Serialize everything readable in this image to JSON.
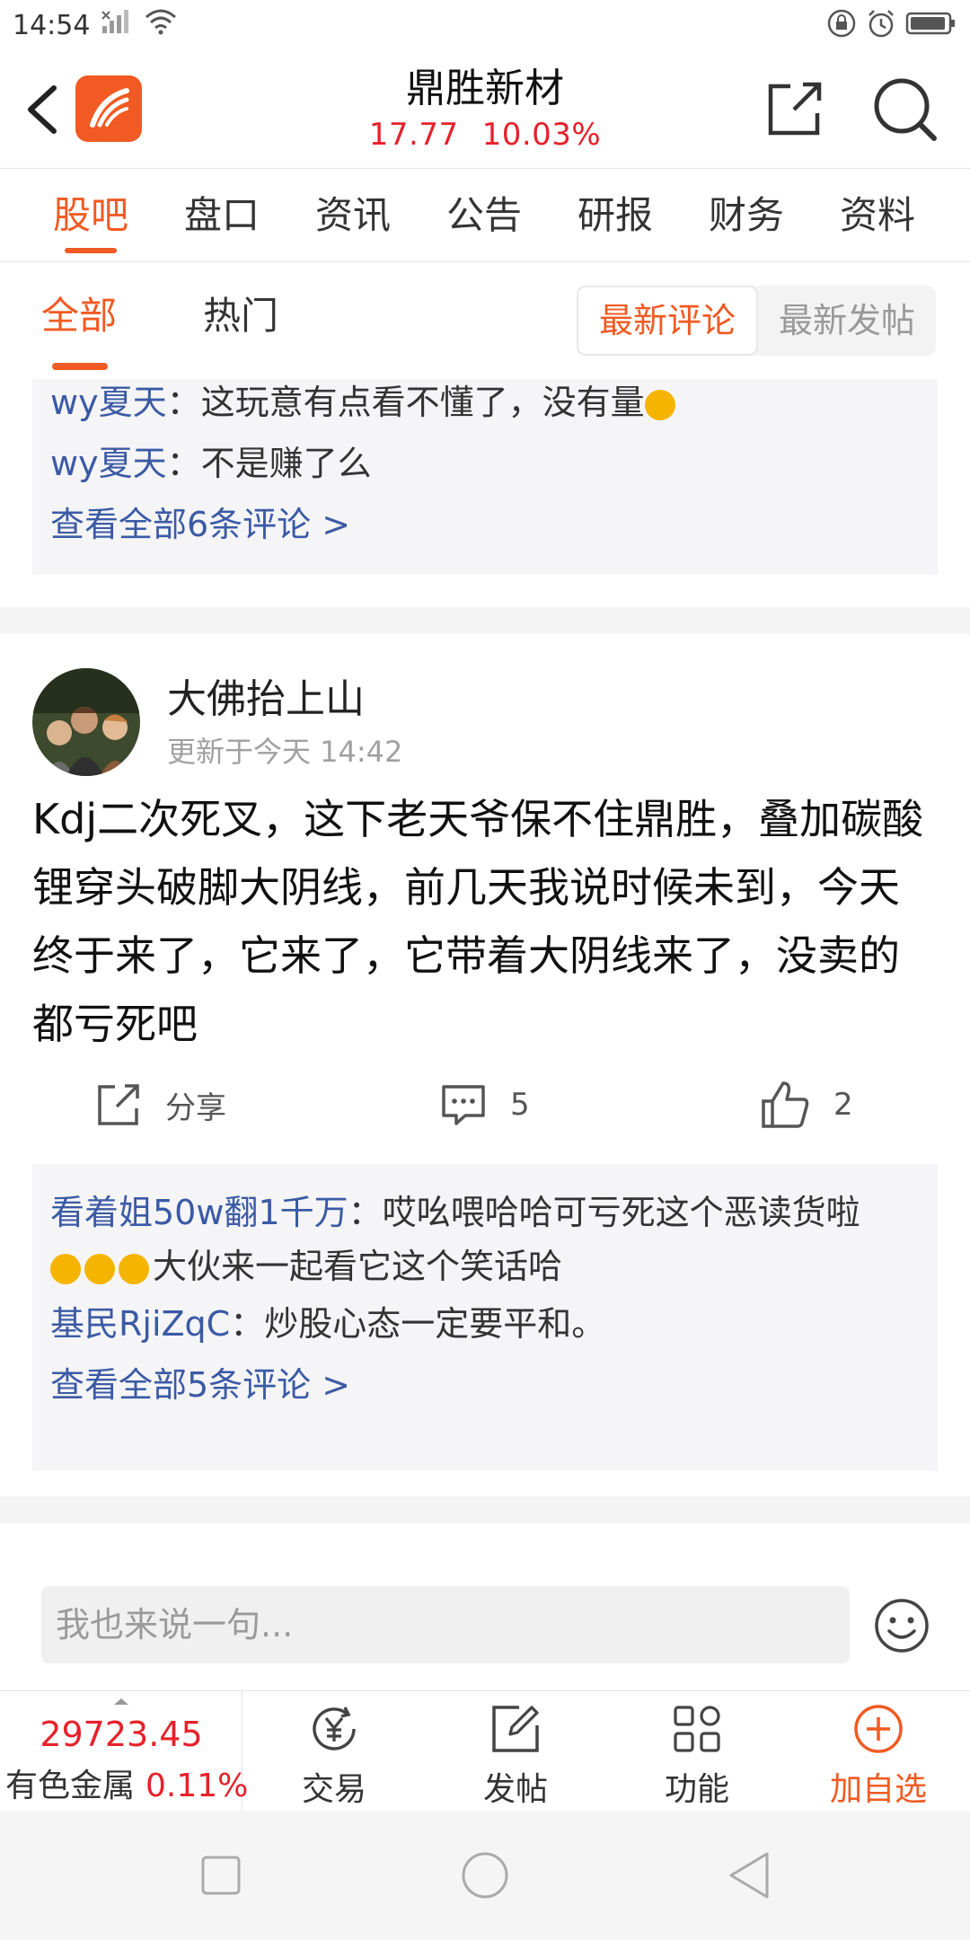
{
  "status_bar": {
    "time": "14:54"
  },
  "header": {
    "title": "鼎胜新材",
    "price": "17.77",
    "change_pct": "10.03%"
  },
  "main_tabs": [
    {
      "label": "股吧"
    },
    {
      "label": "盘口"
    },
    {
      "label": "资讯"
    },
    {
      "label": "公告"
    },
    {
      "label": "研报"
    },
    {
      "label": "财务"
    },
    {
      "label": "资料"
    }
  ],
  "sub_tabs": {
    "all": "全部",
    "hot": "热门",
    "sort_latest_comment": "最新评论",
    "sort_latest_post": "最新发帖"
  },
  "prev_post": {
    "comments": [
      {
        "user": "wy夏天",
        "text": "：这玩意有点看不懂了，没有量"
      },
      {
        "user": "wy夏天",
        "text": "：不是赚了么"
      }
    ],
    "view_all": "查看全部6条评论 >"
  },
  "post": {
    "author": "大佛抬上山",
    "time": "更新于今天 14:42",
    "body": "Kdj二次死叉，这下老天爷保不住鼎胜，叠加碳酸锂穿头破脚大阴线，前几天我说时候未到，今天终于来了，它来了，它带着大阴线来了，没卖的都亏死吧",
    "share_label": "分享",
    "comment_count": "5",
    "like_count": "2",
    "comments": [
      {
        "user": "看着姐50w翻1千万",
        "text": "：哎吆喂哈哈可亏死这个恶读货啦",
        "text2": "大伙来一起看它这个笑话哈"
      },
      {
        "user": "基民RjiZqC",
        "text": "：炒股心态一定要平和。"
      }
    ],
    "view_all": "查看全部5条评论 >"
  },
  "input": {
    "placeholder": "我也来说一句..."
  },
  "toolbar": {
    "index_value": "29723.45",
    "index_name": "有色金属",
    "index_pct": "0.11%",
    "items": [
      {
        "label": "交易",
        "icon": "yuan-exchange-icon"
      },
      {
        "label": "发帖",
        "icon": "edit-icon"
      },
      {
        "label": "功能",
        "icon": "grid-icon"
      },
      {
        "label": "加自选",
        "icon": "add-circle-icon"
      }
    ]
  },
  "colors": {
    "accent": "#f15a22",
    "up": "#e6212a",
    "link": "#3b5aa5"
  }
}
